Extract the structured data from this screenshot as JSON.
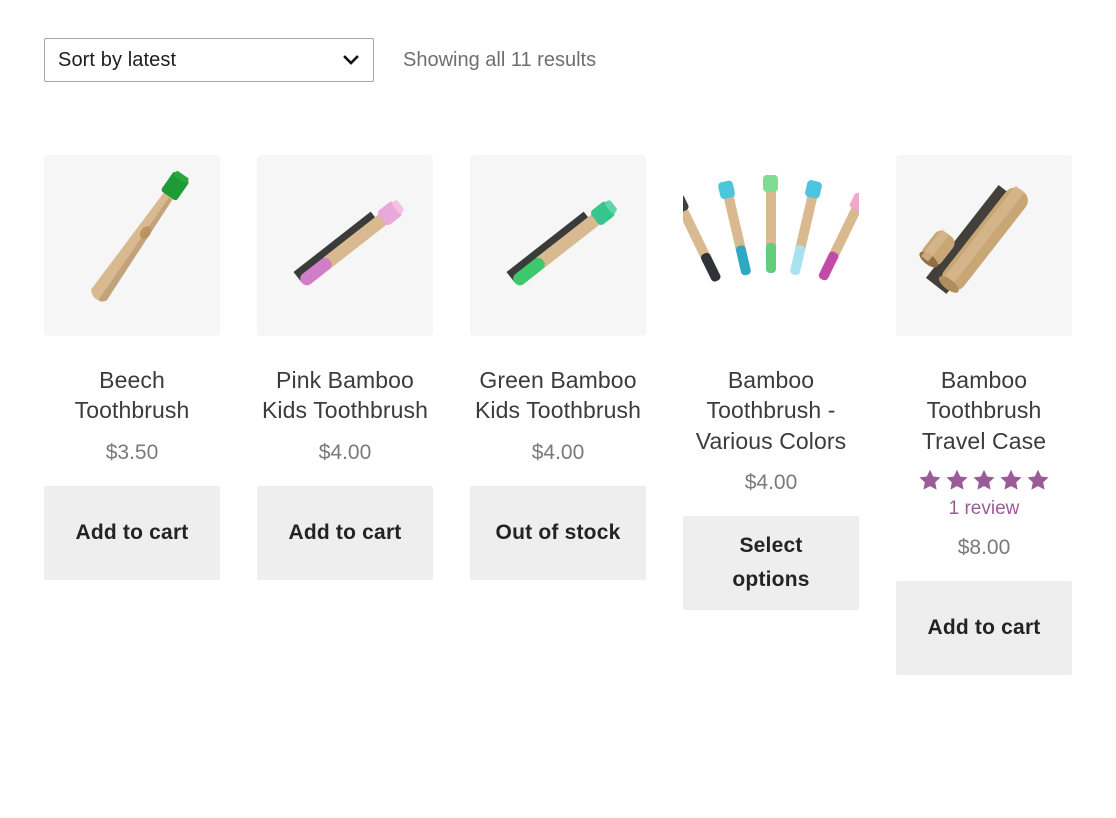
{
  "toolbar": {
    "sort_selected": "Sort by latest",
    "sort_options": [
      "Sort by latest"
    ],
    "results_text": "Showing all 11 results",
    "chevron_icon": "chevron-down-icon"
  },
  "colors": {
    "star": "#9b5b96",
    "review_link": "#9b5b96",
    "title": "#3b3b3b",
    "price": "#7a7a7a",
    "button_bg": "#eeeeee",
    "button_text": "#232323",
    "thumb_bg": "#f6f6f6"
  },
  "products": [
    {
      "title": "Beech Toothbrush",
      "price": "$3.50",
      "action_label": "Add to cart",
      "rating": null,
      "review_text": null,
      "thumb_style": "tile",
      "image_name": "beech-toothbrush-green-bristles"
    },
    {
      "title": "Pink Bamboo Kids Toothbrush",
      "price": "$4.00",
      "action_label": "Add to cart",
      "rating": null,
      "review_text": null,
      "thumb_style": "tile",
      "image_name": "pink-bamboo-kids-toothbrush"
    },
    {
      "title": "Green Bamboo Kids Toothbrush",
      "price": "$4.00",
      "action_label": "Out of stock",
      "rating": null,
      "review_text": null,
      "thumb_style": "tile",
      "image_name": "green-bamboo-kids-toothbrush"
    },
    {
      "title": "Bamboo Toothbrush - Various Colors",
      "price": "$4.00",
      "action_label": "Select options",
      "rating": null,
      "review_text": null,
      "thumb_style": "plain",
      "image_name": "bamboo-toothbrush-various-colors"
    },
    {
      "title": "Bamboo Toothbrush Travel Case",
      "price": "$8.00",
      "action_label": "Add to cart",
      "rating": 5,
      "review_text": "1 review",
      "thumb_style": "tile",
      "image_name": "bamboo-toothbrush-travel-case"
    }
  ]
}
